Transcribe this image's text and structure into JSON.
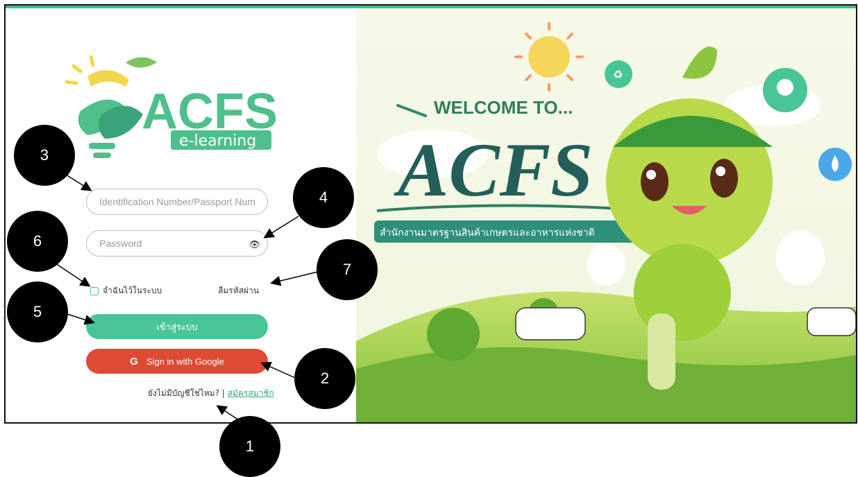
{
  "login": {
    "id_placeholder": "Identification Number/Passport Num",
    "password_placeholder": "Password",
    "remember_label": "จำฉันไว้ในระบบ",
    "forgot_label": "ลืมรหัสผ่าน",
    "login_button": "เข้าสู่ระบบ",
    "google_button": "Sign in with Google",
    "no_account_text": "ยังไม่มีบัญชีใช่ไหม? |",
    "register_link": "สมัครสมาชิก"
  },
  "logo": {
    "title": "ACFS",
    "subtitle": "e-learning"
  },
  "banner": {
    "welcome": "WELCOME TO...",
    "title": "ACFS",
    "agency": "สำนักงานมาตรฐานสินค้าเกษตรและอาหารแห่งชาติ"
  },
  "callouts": [
    "1",
    "2",
    "3",
    "4",
    "5",
    "6",
    "7"
  ],
  "icons": {
    "eye": "eye-icon",
    "google": "google-icon",
    "recycle": "recycle-icon",
    "bulb": "lightbulb-icon",
    "drop": "water-drop-icon"
  },
  "colors": {
    "accent_green": "#48c596",
    "google_red": "#de4a33",
    "topbar": "#3fbf8f"
  }
}
